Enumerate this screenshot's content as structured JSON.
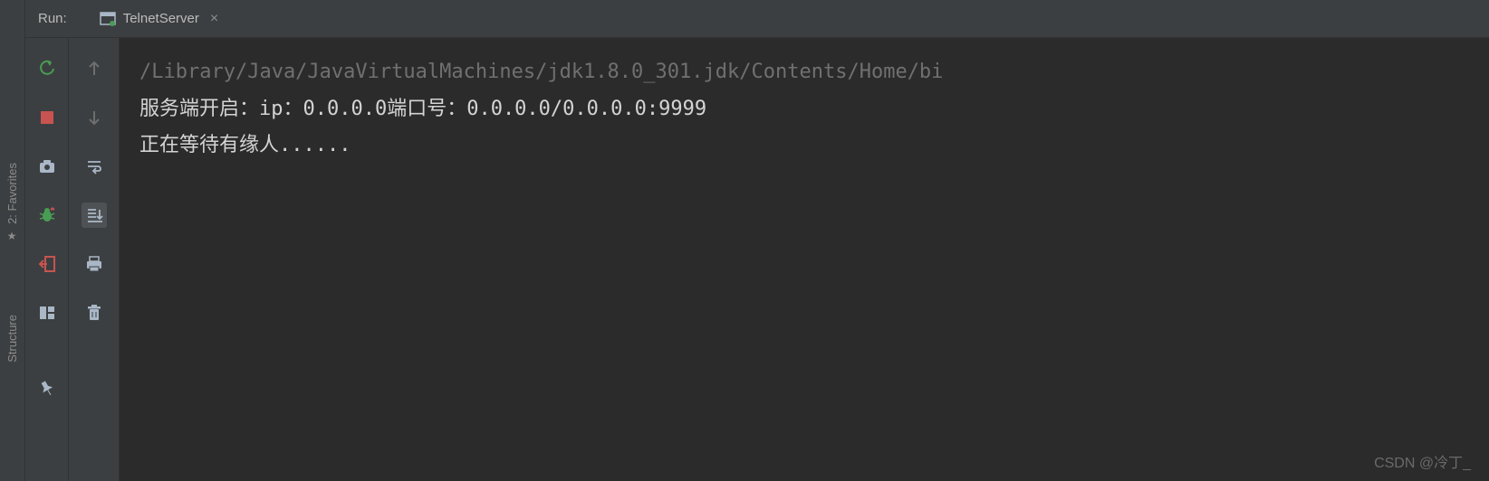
{
  "sidebar": {
    "favorites": "2: Favorites",
    "structure": "Structure"
  },
  "header": {
    "run_label": "Run:",
    "tab_label": "TelnetServer"
  },
  "console": {
    "line1": "/Library/Java/JavaVirtualMachines/jdk1.8.0_301.jdk/Contents/Home/bi",
    "line2": "服务端开启：ip：0.0.0.0端口号：0.0.0.0/0.0.0.0:9999",
    "line3": "正在等待有缘人......"
  },
  "watermark": "CSDN @冷丁_"
}
